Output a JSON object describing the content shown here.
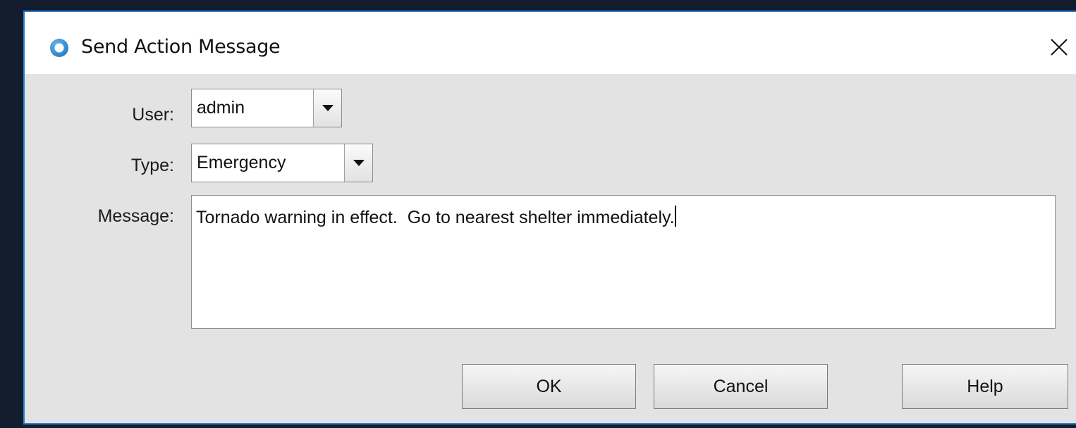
{
  "window": {
    "title": "Send Action Message",
    "icon": "app-ring-icon"
  },
  "form": {
    "user_label": "User:",
    "user_value": "admin",
    "type_label": "Type:",
    "type_value": "Emergency",
    "message_label": "Message:",
    "message_value": "Tornado warning in effect.  Go to nearest shelter immediately."
  },
  "buttons": {
    "ok": "OK",
    "cancel": "Cancel",
    "help": "Help"
  },
  "colors": {
    "accent": "#2b7fd0",
    "background": "#131c2c",
    "dialog": "#e3e3e3"
  }
}
